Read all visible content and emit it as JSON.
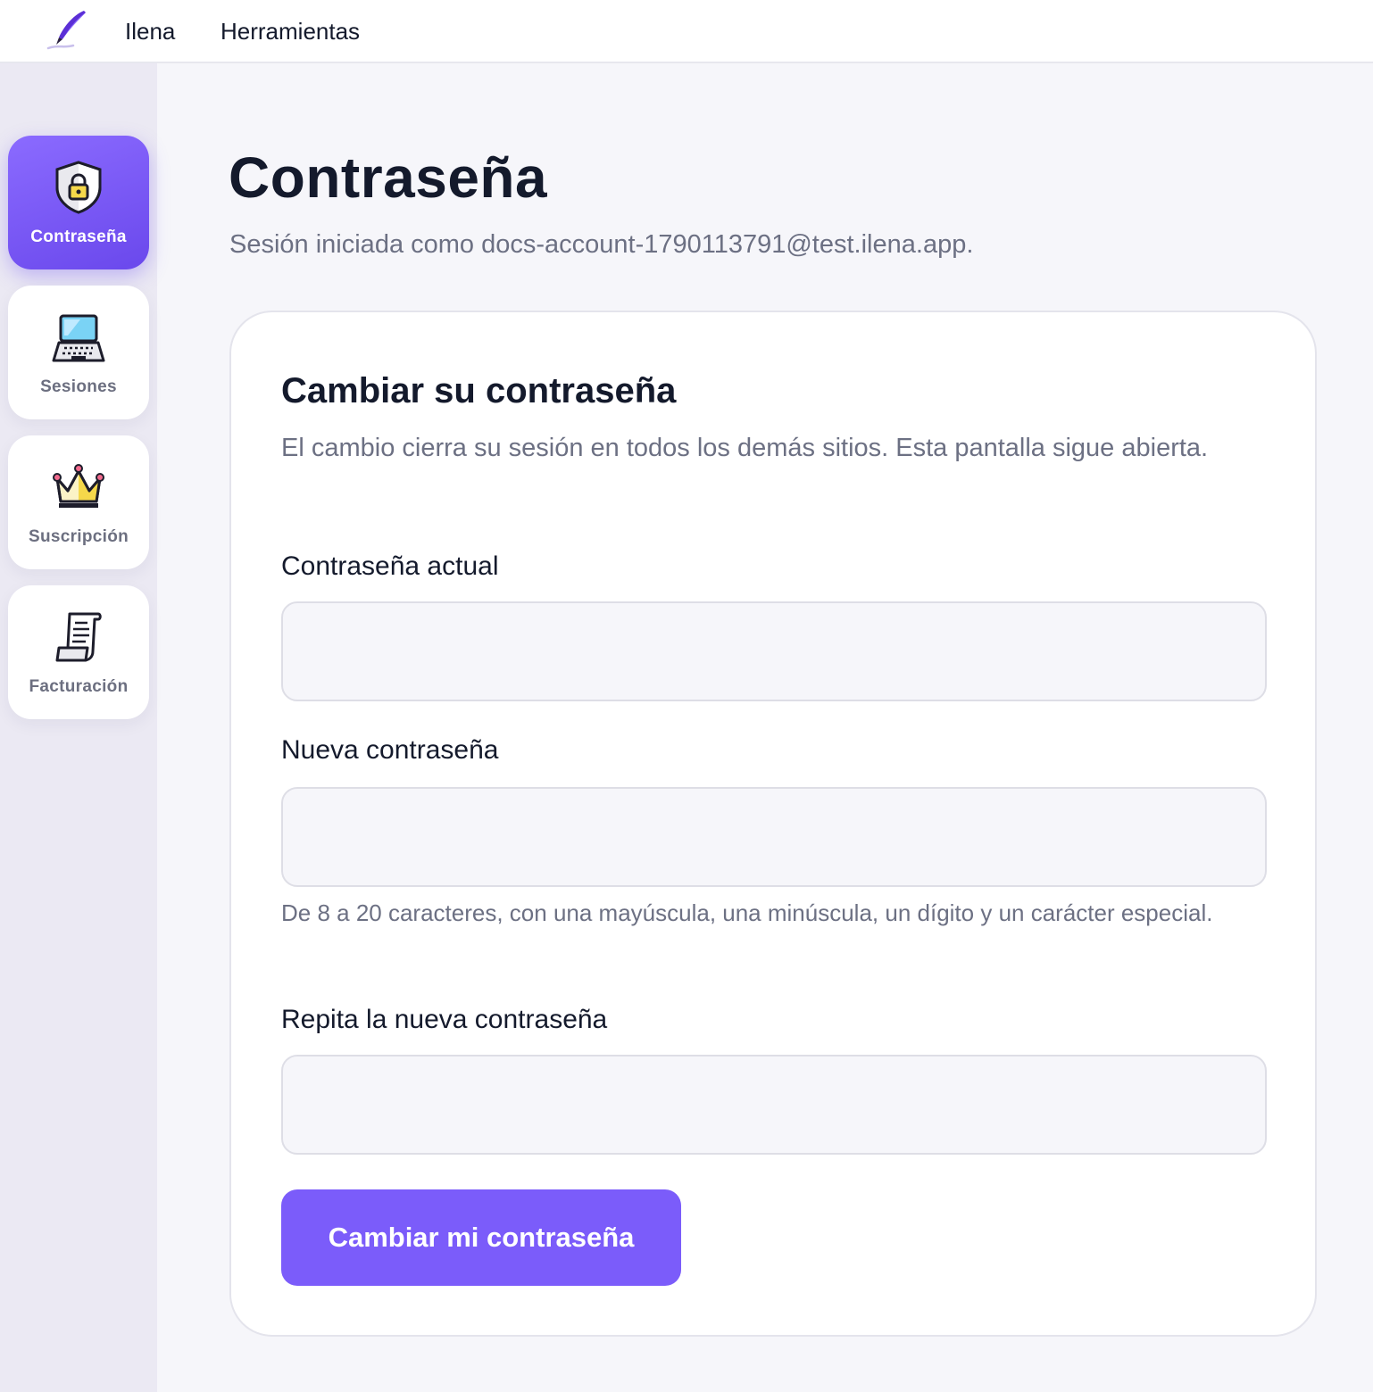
{
  "topbar": {
    "logo_icon": "quill-pen-icon",
    "nav": [
      {
        "label": "Ilena"
      },
      {
        "label": "Herramientas"
      }
    ]
  },
  "sidebar": {
    "items": [
      {
        "label": "Contraseña",
        "icon": "shield-lock-icon",
        "active": true
      },
      {
        "label": "Sesiones",
        "icon": "laptop-icon",
        "active": false
      },
      {
        "label": "Suscripción",
        "icon": "crown-icon",
        "active": false
      },
      {
        "label": "Facturación",
        "icon": "receipt-scroll-icon",
        "active": false
      }
    ]
  },
  "main": {
    "title": "Contraseña",
    "subtitle": "Sesión iniciada como docs-account-1790113791@test.ilena.app.",
    "card": {
      "title": "Cambiar su contraseña",
      "description": "El cambio cierra su sesión en todos los demás sitios. Esta pantalla sigue abierta.",
      "fields": [
        {
          "label": "Contraseña actual",
          "value": "",
          "placeholder": ""
        },
        {
          "label": "Nueva contraseña",
          "value": "",
          "placeholder": ""
        },
        {
          "label": "Repita la nueva contraseña",
          "value": "",
          "placeholder": ""
        }
      ],
      "new_password_hint": "De 8 a 20 caracteres, con una mayúscula, una minúscula, un dígito y un carácter especial.",
      "submit_label": "Cambiar mi contraseña"
    }
  },
  "colors": {
    "accent": "#7b5cfa",
    "active_tab_gradient_start": "#8b6bff",
    "active_tab_gradient_end": "#6a48ec",
    "page_background": "#f6f6fa",
    "sidebar_background": "#ebe9f3",
    "heading_text": "#141a2c",
    "muted_text": "#6c7083"
  }
}
